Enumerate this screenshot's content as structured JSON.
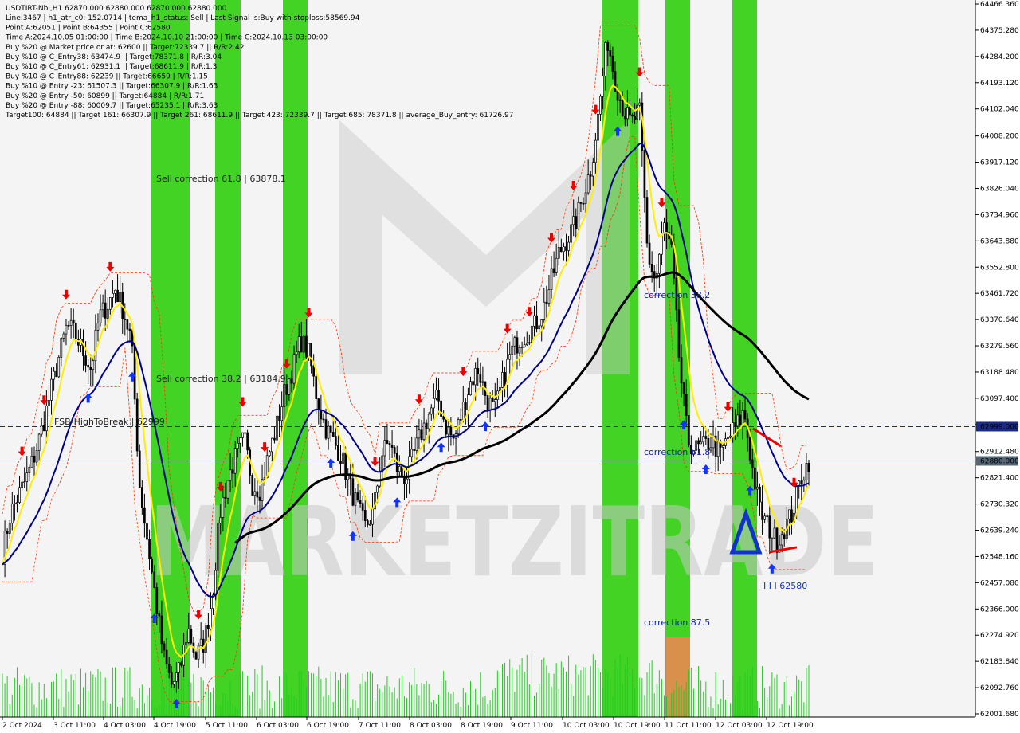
{
  "window": {
    "info_lines": [
      "USDTIRT-Nbi,H1  62870.000 62880.000 62870.000 62880.000",
      "Line:3467  | h1_atr_c0: 152.0714  |  tema_h1_status: Sell  |  Last Signal is:Buy with stoploss:58569.94",
      "Point A:62051  | Point B:64355  | Point C:62580",
      "Time A:2024.10.05 01:00:00  | Time B:2024.10.10 21:00:00  |  Time C:2024.10.13 03:00:00",
      "Buy %20 @ Market price or at: 62600  || Target:72339.7  || R/R:2.42",
      "Buy %10 @ C_Entry38: 63474.9  || Target:78371.8  | R/R:3.04",
      "Buy %10 @ C_Entry61: 62931.1  || Target:68611.9  | R/R:1.3",
      "Buy %10 @ C_Entry88: 62239  || Target:66659  | R/R:1.15",
      "Buy %10 @ Entry -23: 61507.3  || Target:66307.9  | R/R:1.63",
      "Buy %20 @ Entry -50: 60899  || Target:64884  | R/R:1.71",
      "Buy %20 @ Entry -88: 60009.7  || Target:65235.1  | R/R:3.63",
      "Target100: 64884  || Target 161: 66307.9  || Target 261: 68611.9  || Target 423: 72339.7  || Target 685: 78371.8  || average_Buy_entry: 61726.97"
    ]
  },
  "colors": {
    "background": "#ffffff",
    "panel_bg": "#f4f4f4",
    "green_zone": "#22cc00",
    "orange_zone": "#d9904a",
    "candle": "#000000",
    "yellow_line": "#ffee00",
    "navy_line": "#00008b",
    "black_ma": "#000000",
    "red_dashed": "#ff3300",
    "volume": "#22cc22",
    "blue_arrow": "#1133ff",
    "red_arrow": "#ee0000",
    "hline_dashed": "#1a2a88",
    "hline_solid": "#556677",
    "watermark": "#c8c8c8"
  },
  "annotations": {
    "sell_correction_618": "Sell correction 61.8 | 63878.1",
    "sell_correction_382": "Sell correction 38.2 | 63184.9",
    "fsb_label": "FSB-HighToBreak  |  62999",
    "correction_382": "correction 38.2",
    "correction_618": "correction 61.8",
    "correction_875": "correction 87.5",
    "point_c_label": "I I I  62580",
    "watermark": "MARKETZITRADE"
  },
  "price_badges": {
    "fsb_price": "62999.000",
    "current_price": "62880.000"
  },
  "chart_data": {
    "type": "candlestick",
    "symbol": "USDTIRT-Nbi",
    "timeframe": "H1",
    "ylim": [
      62001.68,
      64466.36
    ],
    "y_ticks": [
      "64466.360",
      "64375.280",
      "64284.200",
      "64193.120",
      "64102.040",
      "64008.200",
      "63917.120",
      "63826.040",
      "63734.960",
      "63643.880",
      "63552.800",
      "63461.720",
      "63370.640",
      "63279.560",
      "63188.480",
      "63097.400",
      "63006.320",
      "62912.480",
      "62821.400",
      "62730.320",
      "62639.240",
      "62548.160",
      "62457.080",
      "62366.000",
      "62274.920",
      "62183.840",
      "62092.760",
      "62001.680"
    ],
    "x_ticks": [
      "2 Oct 2024",
      "3 Oct 11:00",
      "4 Oct 03:00",
      "4 Oct 19:00",
      "5 Oct 11:00",
      "6 Oct 03:00",
      "6 Oct 19:00",
      "7 Oct 11:00",
      "8 Oct 03:00",
      "8 Oct 19:00",
      "9 Oct 11:00",
      "10 Oct 03:00",
      "10 Oct 19:00",
      "11 Oct 11:00",
      "12 Oct 03:00",
      "12 Oct 19:00"
    ],
    "close_path": [
      62560,
      62700,
      62760,
      62820,
      62900,
      63000,
      63120,
      63240,
      63350,
      63320,
      63260,
      63200,
      63380,
      63420,
      63480,
      63400,
      63300,
      62800,
      62600,
      62400,
      62200,
      62100,
      62150,
      62300,
      62200,
      62250,
      62400,
      62700,
      62820,
      62900,
      62960,
      62800,
      62780,
      62900,
      63000,
      63120,
      63200,
      63300,
      63250,
      63100,
      63000,
      62950,
      62900,
      62800,
      62720,
      62650,
      62700,
      62900,
      62950,
      62850,
      62820,
      62900,
      62980,
      63050,
      63100,
      63000,
      62950,
      63050,
      63150,
      63200,
      63100,
      63050,
      63150,
      63250,
      63300,
      63320,
      63350,
      63400,
      63500,
      63600,
      63650,
      63700,
      63800,
      63900,
      64100,
      64350,
      64200,
      64100,
      64050,
      64100,
      63600,
      63500,
      63700,
      63600,
      63200,
      62950,
      62920,
      62930,
      62950,
      62900,
      62960,
      63000,
      63050,
      62850,
      62700,
      62650,
      62600,
      62650,
      62700,
      62820,
      62880
    ],
    "levels": {
      "fsb_high_to_break": 62999,
      "current": 62880,
      "point_a": 62051,
      "point_b": 64355,
      "point_c": 62580
    }
  }
}
